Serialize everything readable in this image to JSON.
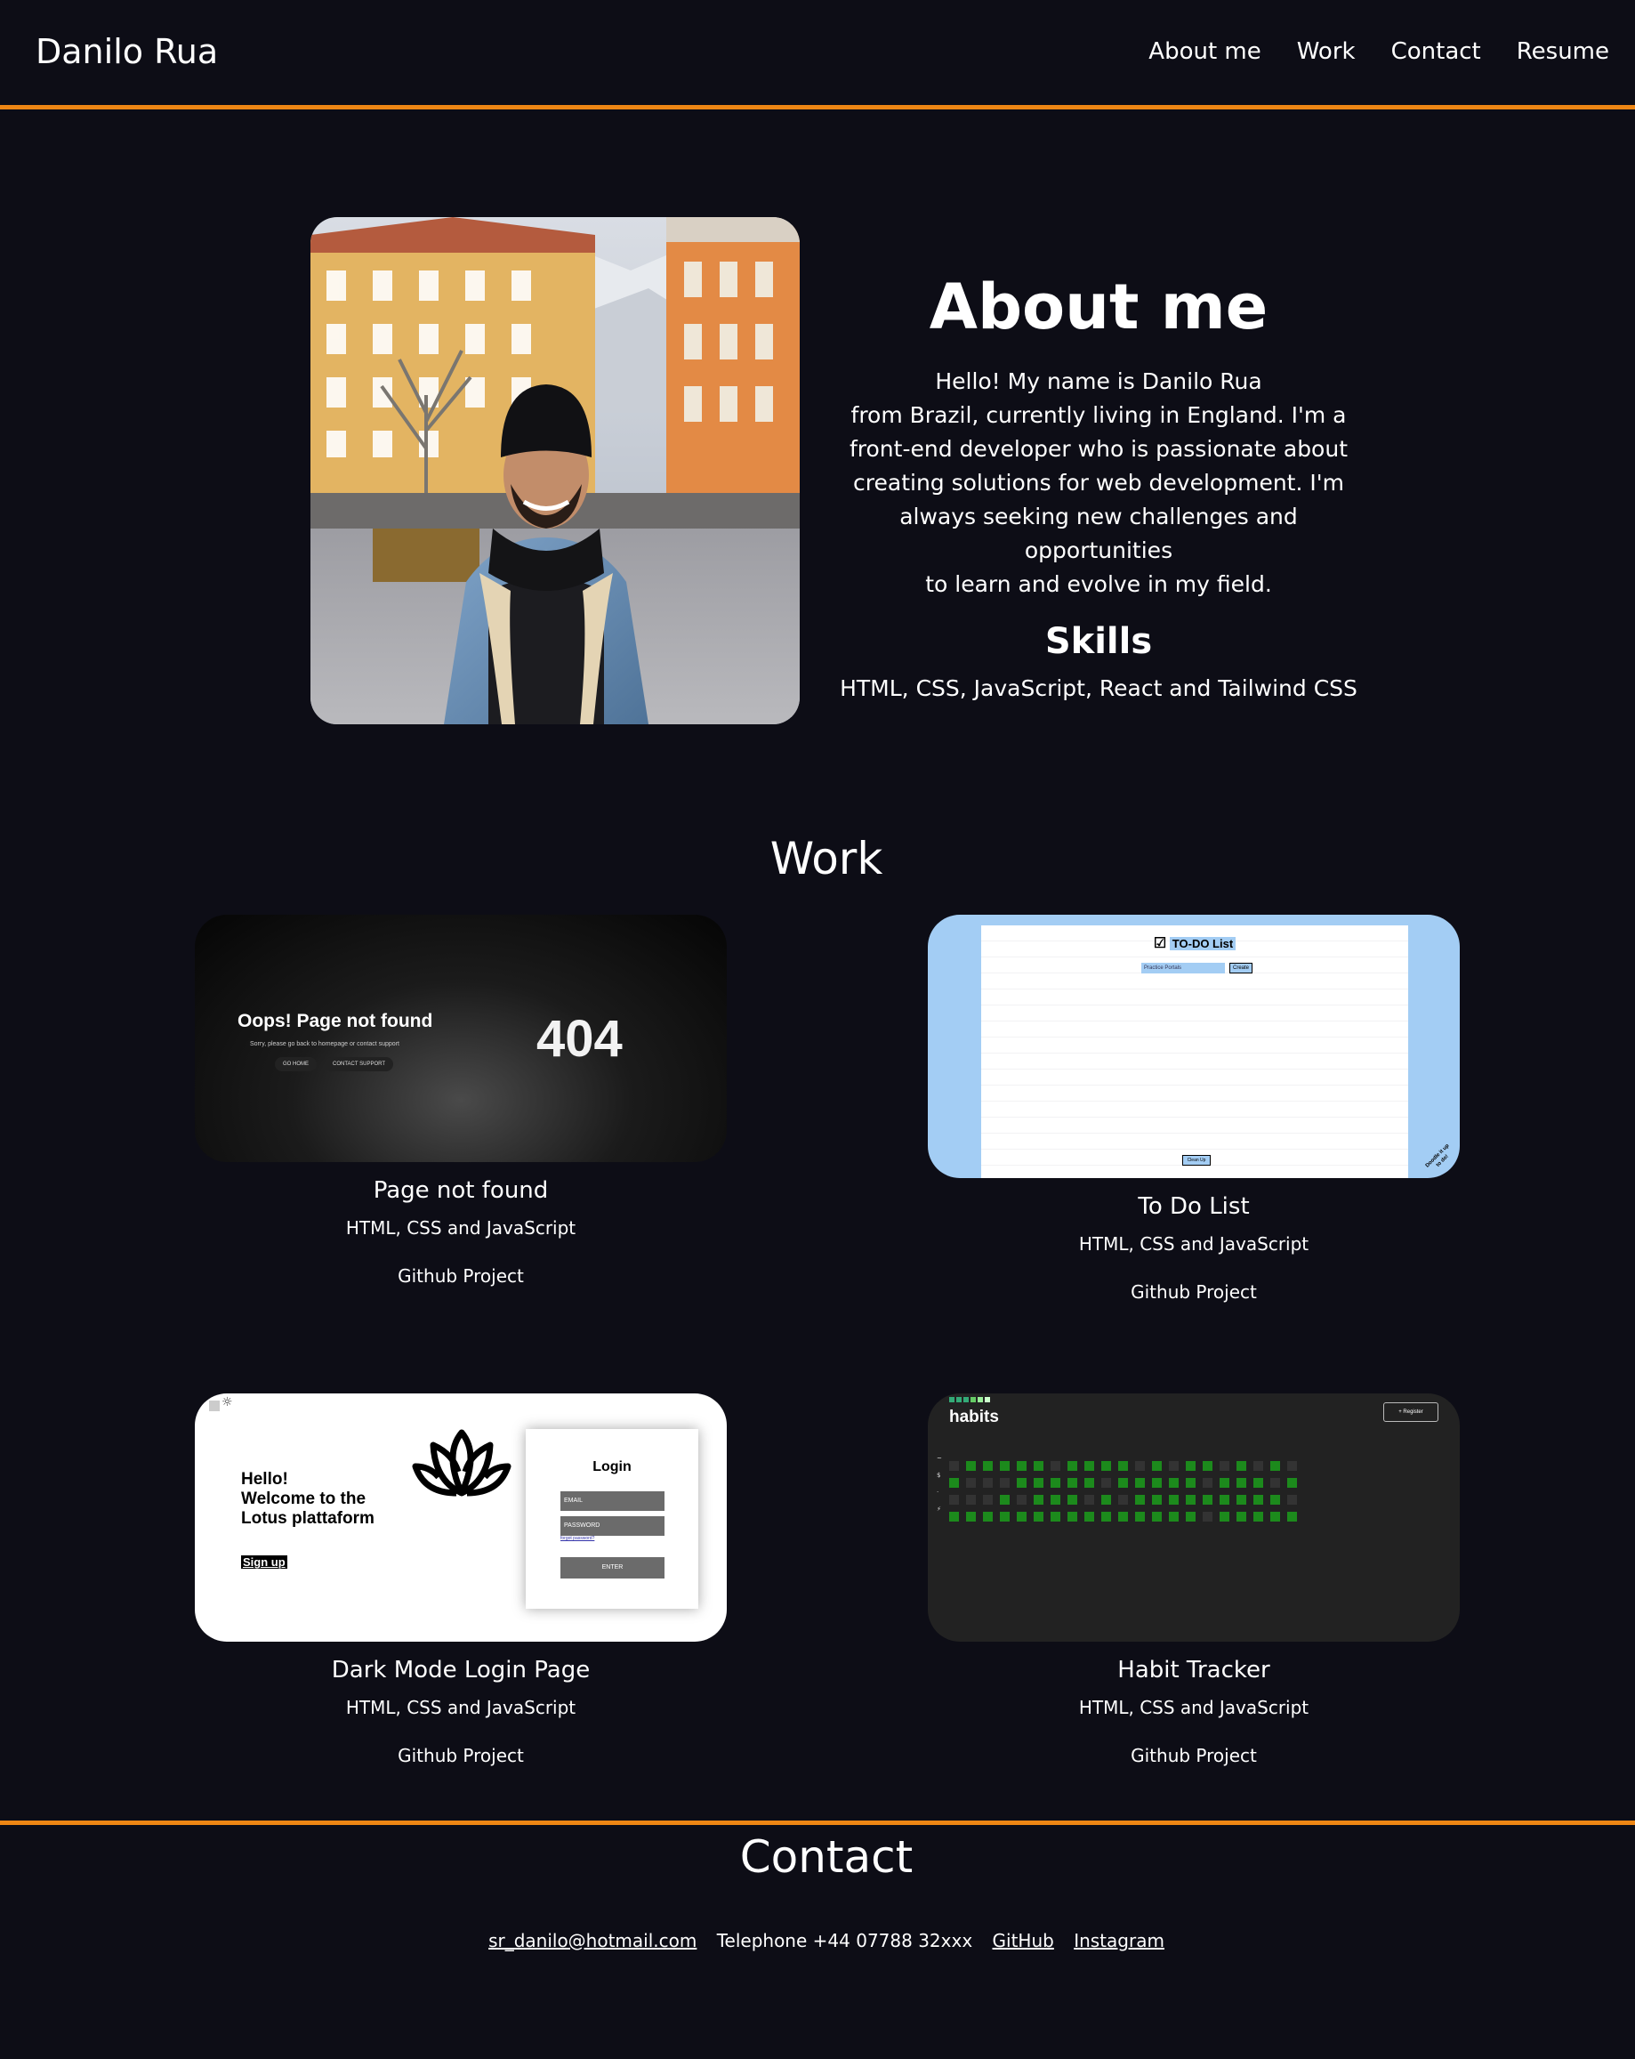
{
  "header": {
    "brand": "Danilo Rua",
    "nav": [
      "About me",
      "Work",
      "Contact",
      "Resume"
    ]
  },
  "about": {
    "title": "About me",
    "lines": [
      "Hello! My name is Danilo Rua",
      "from Brazil, currently living in England. I'm a",
      "front-end developer who is passionate about",
      "creating solutions for web development. I'm",
      "always seeking new challenges and opportunities",
      "to learn and evolve in my field."
    ],
    "skills_title": "Skills",
    "skills": "HTML, CSS, JavaScript, React and Tailwind CSS"
  },
  "work": {
    "title": "Work",
    "projects": [
      {
        "name": "Page not found",
        "tech": "HTML, CSS and JavaScript",
        "link": "Github Project",
        "thumb": {
          "heading": "Oops! Page not found",
          "sub": "Sorry, please go back to homepage or contact support",
          "buttons": [
            "GO HOME",
            "CONTACT SUPPORT"
          ],
          "code": "404"
        }
      },
      {
        "name": "To Do List",
        "tech": "HTML, CSS and JavaScript",
        "link": "Github Project",
        "thumb": {
          "heading": "TO-DO List",
          "input_placeholder": "Practice Portals",
          "add_button": "Create",
          "clear_button": "Clean Up",
          "corner_note": "Doodle it up to do!"
        }
      },
      {
        "name": "Dark Mode Login Page",
        "tech": "HTML, CSS and JavaScript",
        "link": "Github Project",
        "thumb": {
          "greeting": [
            "Hello!",
            "Welcome to the",
            "Lotus plattaform"
          ],
          "signup": "Sign up",
          "login_title": "Login",
          "email": "EMAIL",
          "password": "PASSWORD",
          "forgot": "forgot password?",
          "enter": "ENTER"
        }
      },
      {
        "name": "Habit Tracker",
        "tech": "HTML, CSS and JavaScript",
        "link": "Github Project",
        "thumb": {
          "title": "habits",
          "register": "+ Register",
          "row_icons": [
            "~",
            "$",
            "·",
            "⚡"
          ],
          "grid": [
            [
              0,
              1,
              1,
              1,
              1,
              1,
              0,
              1,
              1,
              1,
              1,
              0,
              1,
              0,
              1,
              1,
              0,
              1,
              0,
              1,
              0
            ],
            [
              1,
              0,
              0,
              0,
              1,
              1,
              1,
              1,
              1,
              0,
              1,
              1,
              1,
              1,
              1,
              0,
              1,
              1,
              1,
              0,
              1
            ],
            [
              0,
              0,
              0,
              1,
              0,
              1,
              1,
              1,
              0,
              1,
              0,
              1,
              1,
              1,
              1,
              1,
              1,
              1,
              1,
              1,
              0
            ],
            [
              1,
              1,
              1,
              1,
              1,
              1,
              1,
              1,
              1,
              1,
              1,
              1,
              1,
              1,
              1,
              0,
              1,
              1,
              1,
              1,
              1
            ]
          ]
        }
      }
    ]
  },
  "contact": {
    "title": "Contact",
    "email": "sr_danilo@hotmail.com",
    "telephone": "Telephone +44 07788 32xxx",
    "github": "GitHub",
    "instagram": "Instagram"
  },
  "colors": {
    "background": "#0d0d16",
    "accent": "#ee8614",
    "text": "#ffffff",
    "todo_bg": "#a3cdf4",
    "habit_bg": "#222222",
    "habit_on": "#1c8a1c",
    "habit_off": "#333333"
  }
}
